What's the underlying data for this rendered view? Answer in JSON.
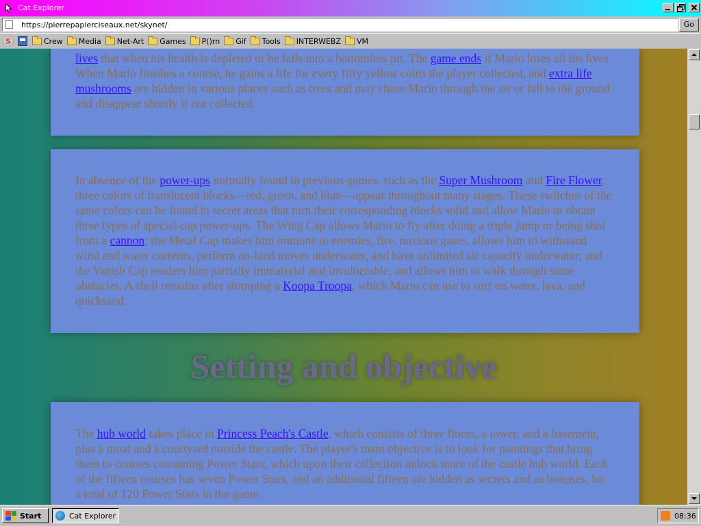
{
  "window": {
    "title": "Cat Explorer"
  },
  "address": {
    "url": "https://pierrepapierciseaux.net/skynet/",
    "go_label": "Go"
  },
  "bookmarks": [
    "Crew",
    "Media",
    "Net-Art",
    "Games",
    "P()rn",
    "Gif",
    "Tools",
    "INTERWEBZ",
    "VM"
  ],
  "content": {
    "p1": [
      {
        "t": "lives",
        "link": true
      },
      {
        "t": " that when his health is depleted or he falls into a bottomless pit. The ",
        "link": false
      },
      {
        "t": "game ends",
        "link": true
      },
      {
        "t": " if Mario loses all his lives. When Mario finishes a course, he gains a life for every fifty yellow coins the player collected, and ",
        "link": false
      },
      {
        "t": "extra life mushrooms",
        "link": true
      },
      {
        "t": " are hidden in various places such as trees and may chase Mario through the air or fall to the ground and disappear shortly if not collected.",
        "link": false
      }
    ],
    "p2": [
      {
        "t": "In absence of the ",
        "link": false
      },
      {
        "t": "power-ups",
        "link": true
      },
      {
        "t": " normally found in previous games, such as the ",
        "link": false
      },
      {
        "t": "Super Mushroom",
        "link": true
      },
      {
        "t": " and ",
        "link": false
      },
      {
        "t": "Fire Flower",
        "link": true
      },
      {
        "t": ", three colors of translucent blocks—red, green, and blue—appear throughout many stages. These switches of the same colors can be found in secret areas that turn their corresponding blocks solid and allow Mario to obtain three types of special cap power-ups. The Wing Cap allows Mario to fly after doing a triple jump or being shot from a ",
        "link": false
      },
      {
        "t": "cannon",
        "link": true
      },
      {
        "t": "; the Metal Cap makes him immune to enemies, fire, noxious gases, allows him to withstand wind and water currents, perform on-land moves underwater, and have unlimited air capacity underwater; and the Vanish Cap renders him partially immaterial and invulnerable, and allows him to walk through some obstacles. A shell remains after stomping a ",
        "link": false
      },
      {
        "t": "Koopa Troopa",
        "link": true
      },
      {
        "t": ", which Mario can use to surf on water, lava, and quicksand.",
        "link": false
      }
    ],
    "heading": "Setting and objective",
    "p3": [
      {
        "t": "The ",
        "link": false
      },
      {
        "t": "hub world",
        "link": true
      },
      {
        "t": " takes place in ",
        "link": false
      },
      {
        "t": "Princess Peach's Castle",
        "link": true
      },
      {
        "t": ", which consists of three floors, a tower, and a basement, plus a moat and a courtyard outside the castle. The player's main objective is to look for paintings that bring them to courses containing Power Stars, which upon their collection unlock more of the castle hub world. Each of the fifteen courses has seven Power Stars, and an additional fifteen are hidden as secrets and as bonuses, for a total of 120 Power Stars in the game.",
        "link": false
      }
    ]
  },
  "taskbar": {
    "start_label": "Start",
    "task_label": "Cat Explorer",
    "clock": "08:36"
  }
}
